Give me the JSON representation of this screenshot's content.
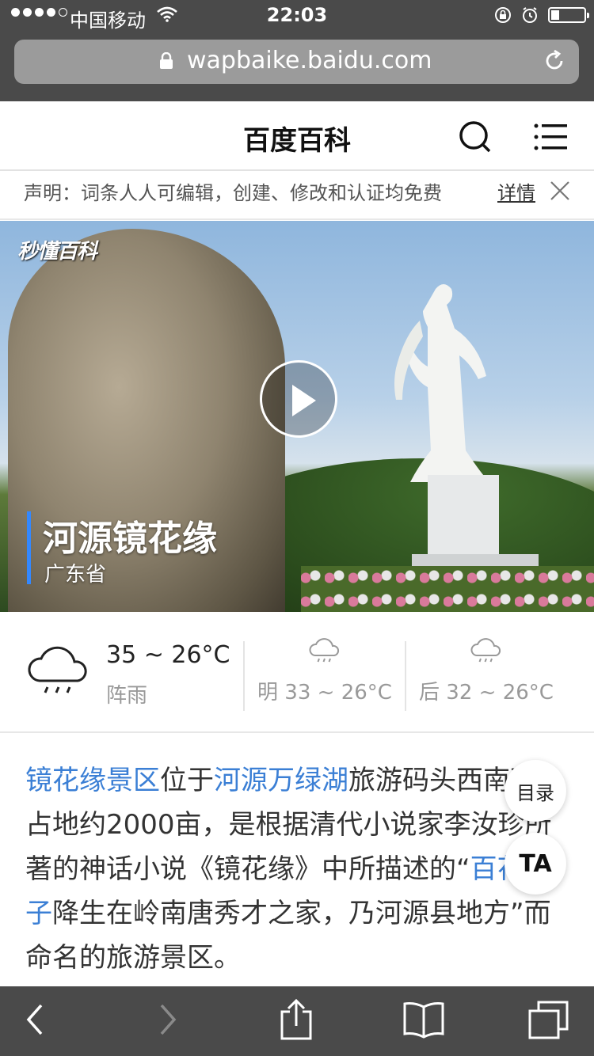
{
  "status": {
    "carrier": "中国移动",
    "time": "22:03"
  },
  "browser": {
    "url": "wapbaike.baidu.com"
  },
  "header": {
    "title": "百度百科"
  },
  "notice": {
    "text": "声明：词条人人可编辑，创建、修改和认证均免费",
    "more": "详情"
  },
  "hero": {
    "logo": "秒懂百科",
    "title": "河源镜花缘",
    "subtitle": "广东省"
  },
  "weather": {
    "today_temp": "35 ~ 26°C",
    "today_desc": "阵雨",
    "tomorrow": "明 33 ~ 26°C",
    "after": "后 32 ~ 26°C"
  },
  "article": {
    "link1": "镜花缘景区",
    "text1": "位于",
    "link2": "河源万绿湖",
    "text2": "旅游码头西南面，占地约2000亩，是根据清代小说家李汝珍所著的神话小说《镜花缘》中所描述的“",
    "link3": "百花仙子",
    "text3": "降生在岭南唐秀才之家，乃河源县地方”而命名的旅游景区。"
  },
  "floating": {
    "toc": "目录",
    "ta": "TA"
  }
}
